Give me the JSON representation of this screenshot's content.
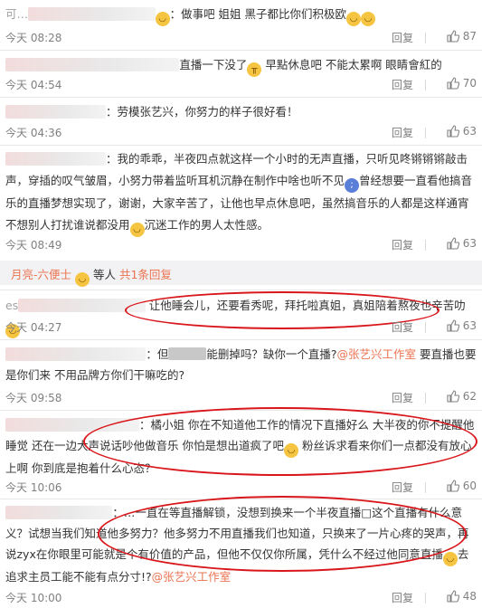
{
  "like_icon": "thumbs-up-icon",
  "reply_label": "回复",
  "accent_color": "#eb7350",
  "comments": [
    {
      "user": "可…",
      "text": "：做事吧 姐姐 黑子都比你们积极欧",
      "time": "今天 08:28",
      "likes": "87"
    },
    {
      "user": "…",
      "text": "直播一下没了",
      "extra": "早點休息吧 不能太累啊 眼睛會紅的",
      "time": "今天 04:54",
      "likes": "70"
    },
    {
      "user": "…",
      "text": "：劳模张艺兴，你努力的样子很好看！",
      "time": "今天 04:36",
      "likes": "63"
    },
    {
      "user": "…",
      "text": "：我的乖乖，半夜四点就这样一个小时的无声直播，只听见咚锵锵锵敲击声，穿插的叹气皱眉，小努力带着监听耳机沉静在制作中啥也听不见",
      "text2": "曾经想要一直看他搞音乐的直播梦想实现了，谢谢，大家辛苦了，让他也早点休息吧，虽然搞音乐的人都是这样通宵不想别人打扰谁说都没用",
      "text3": "沉迷工作的男人太性感。",
      "time": "今天 08:49",
      "likes": "63"
    },
    {
      "reply_name": "月亮-六便士",
      "reply_rest": "等人",
      "reply_count": "共1条回复"
    },
    {
      "user": "es",
      "text": "让他睡会儿，还要看秀呢，拜托啦真姐，真姐陪着熬夜也辛苦叻",
      "time": "今天 04:27",
      "likes": "63"
    },
    {
      "user": "…",
      "text": "：但",
      "mid": "能删掉吗？缺你一个直播?",
      "mention": "@张艺兴工作室",
      "rest": "要直播也要是你们来 不用品牌方你们干嘛吃的?",
      "time": "今天 09:58",
      "likes": "62"
    },
    {
      "user": "…",
      "text": "：橘小姐 你在不知道他工作的情况下直播好么 大半夜的你不提醒他睡觉 还在一边大声说话吵他做音乐 你怕是想出道疯了吧",
      "rest": "粉丝诉求看来你们一点都没有放心上啊 你到底是抱着什么心态？",
      "time": "今天 10:06",
      "likes": "60"
    },
    {
      "user": "…",
      "text": "：…一直在等直播解锁，没想到换来一个半夜直播□这个直播有什么意义？试想当我们知道他多努力？他多努力不用直播我们也知道，只换来了一片心疼的哭声，再说zyx在你眼里可能就是个有价值的产品，但他不仅仅你所属，凭什么不经过他同意直播",
      "rest": "去追求主员工能不能有点分寸!?",
      "mention": "@张艺兴工作室",
      "time": "今天 10:00",
      "likes": "48"
    }
  ]
}
